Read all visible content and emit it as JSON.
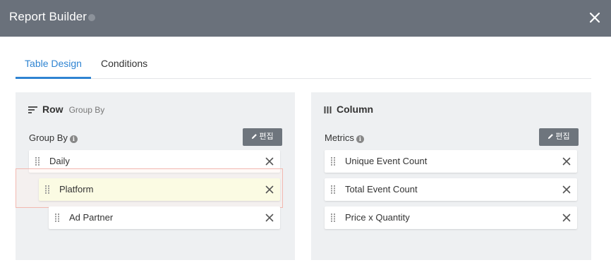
{
  "header": {
    "title": "Report Builder"
  },
  "tabs": [
    {
      "label": "Table Design",
      "active": true
    },
    {
      "label": "Conditions",
      "active": false
    }
  ],
  "row_panel": {
    "title": "Row",
    "subtitle": "Group By",
    "section_label": "Group By",
    "edit_label": "편집",
    "items": [
      {
        "label": "Daily"
      },
      {
        "label": "Platform"
      },
      {
        "label": "Ad Partner"
      }
    ]
  },
  "column_panel": {
    "title": "Column",
    "section_label": "Metrics",
    "edit_label": "편집",
    "items": [
      {
        "label": "Unique Event Count"
      },
      {
        "label": "Total Event Count"
      },
      {
        "label": "Price x Quantity"
      }
    ]
  },
  "colors": {
    "header_bg": "#6a717b",
    "accent": "#2f84d2",
    "panel_bg": "#eef0f2",
    "button_bg": "#6e757d",
    "drag_highlight": "#fbfbe3",
    "drop_border": "#f2b8b0"
  },
  "icons": [
    "info-icon",
    "close-icon",
    "sort-lines-icon",
    "columns-icon",
    "pencil-icon",
    "drag-handle-icon",
    "remove-icon"
  ]
}
